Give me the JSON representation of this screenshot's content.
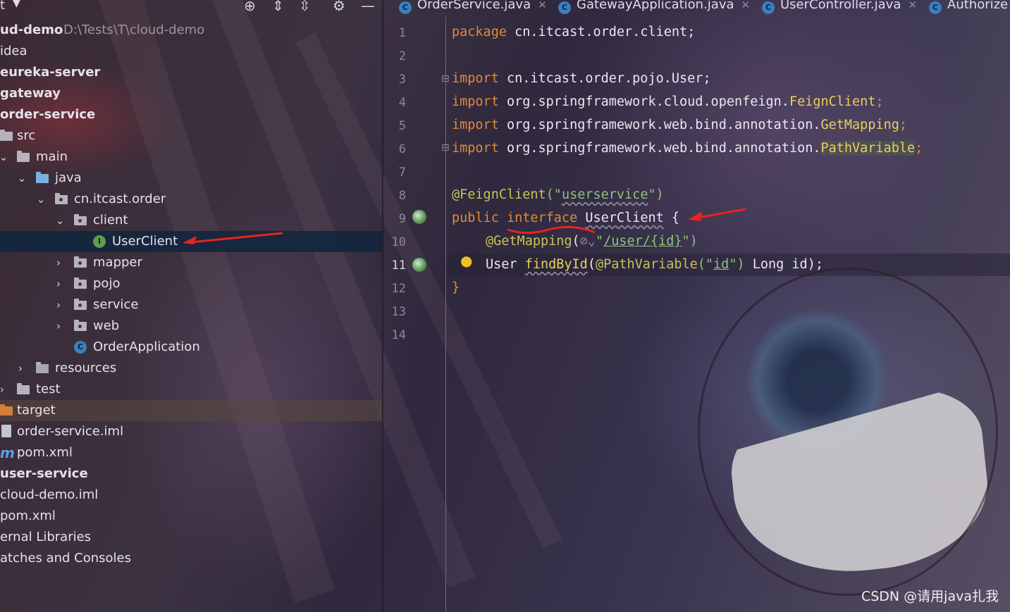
{
  "project_panel": {
    "title": "t",
    "toolbar_icons": [
      "crosshair-icon",
      "expand-all-icon",
      "collapse-all-icon",
      "gear-icon",
      "minimize-icon"
    ],
    "tree": [
      {
        "label": "ud-demo",
        "path": "D:\\Tests\\T\\cloud-demo",
        "bold": true
      },
      {
        "label": "idea"
      },
      {
        "label": "eureka-server",
        "bold": true
      },
      {
        "label": "gateway",
        "bold": true
      },
      {
        "label": "order-service",
        "bold": true
      },
      {
        "label": "src",
        "icon": "folder-icon"
      },
      {
        "label": "main",
        "icon": "folder-icon",
        "expanded": true
      },
      {
        "label": "java",
        "icon": "source-folder-icon",
        "expanded": true
      },
      {
        "label": "cn.itcast.order",
        "icon": "package-icon",
        "expanded": true
      },
      {
        "label": "client",
        "icon": "package-icon",
        "expanded": true
      },
      {
        "label": "UserClient",
        "icon": "interface-icon",
        "selected": true
      },
      {
        "label": "mapper",
        "icon": "package-icon",
        "expanded": false
      },
      {
        "label": "pojo",
        "icon": "package-icon",
        "expanded": false
      },
      {
        "label": "service",
        "icon": "package-icon",
        "expanded": false
      },
      {
        "label": "web",
        "icon": "package-icon",
        "expanded": false
      },
      {
        "label": "OrderApplication",
        "icon": "spring-boot-class-icon"
      },
      {
        "label": "resources",
        "icon": "resources-folder-icon",
        "expanded": false
      },
      {
        "label": "test",
        "icon": "folder-icon",
        "expanded": false
      },
      {
        "label": "target",
        "icon": "excluded-folder-icon"
      },
      {
        "label": "order-service.iml",
        "icon": "iml-file-icon"
      },
      {
        "label": "pom.xml",
        "icon": "maven-icon"
      },
      {
        "label": "user-service",
        "bold": true
      },
      {
        "label": "cloud-demo.iml"
      },
      {
        "label": "pom.xml"
      },
      {
        "label": "ernal Libraries"
      },
      {
        "label": "atches and Consoles"
      }
    ]
  },
  "tabs": [
    {
      "label": "OrderService.java",
      "icon": "class-icon",
      "closable": true
    },
    {
      "label": "GatewayApplication.java",
      "icon": "spring-boot-class-icon",
      "closable": true
    },
    {
      "label": "UserController.java",
      "icon": "class-icon",
      "closable": true
    },
    {
      "label": "Authorize",
      "icon": "class-icon",
      "closable": false
    }
  ],
  "editor": {
    "current_line": 11,
    "line_numbers": [
      "1",
      "2",
      "3",
      "4",
      "5",
      "6",
      "7",
      "8",
      "9",
      "10",
      "11",
      "12",
      "13",
      "14"
    ],
    "lines": {
      "l1": {
        "kw": "package",
        "rest": " cn.itcast.order.client;"
      },
      "l3": {
        "kw": "import",
        "rest": " cn.itcast.order.pojo.User;"
      },
      "l4": {
        "kw": "import",
        "rest": " org.springframework.cloud.openfeign.",
        "cls": "FeignClient",
        "semi": ";"
      },
      "l5": {
        "kw": "import",
        "rest": " org.springframework.web.bind.annotation.",
        "cls": "GetMapping",
        "semi": ";"
      },
      "l6": {
        "kw": "import",
        "rest": " org.springframework.web.bind.annotation.",
        "cls": "PathVariable",
        "semi": ";"
      },
      "l8": {
        "ann": "@FeignClient",
        "open": "(\"",
        "str": "userservice",
        "close": "\")"
      },
      "l9": {
        "kw1": "public",
        "kw2": "interface",
        "name": "UserClient",
        "brace": " {"
      },
      "l10": {
        "ann": "@GetMapping",
        "open": "(",
        "q1": "\"",
        "str": "/user/{id}",
        "q2": "\")"
      },
      "l11": {
        "type": "User",
        "method": "findById",
        "paren": "(",
        "ann": "@PathVariable",
        "arg_open": "(\"",
        "arg": "id",
        "arg_close": "\")",
        "rest": " Long id);"
      },
      "l12": {
        "brace": "}"
      }
    }
  },
  "watermark": "CSDN @请用java扎我",
  "colors": {
    "arrow": "#e8231e",
    "keyword": "#e08a3c",
    "annotation": "#c8c25a",
    "string": "#8fc37a"
  }
}
